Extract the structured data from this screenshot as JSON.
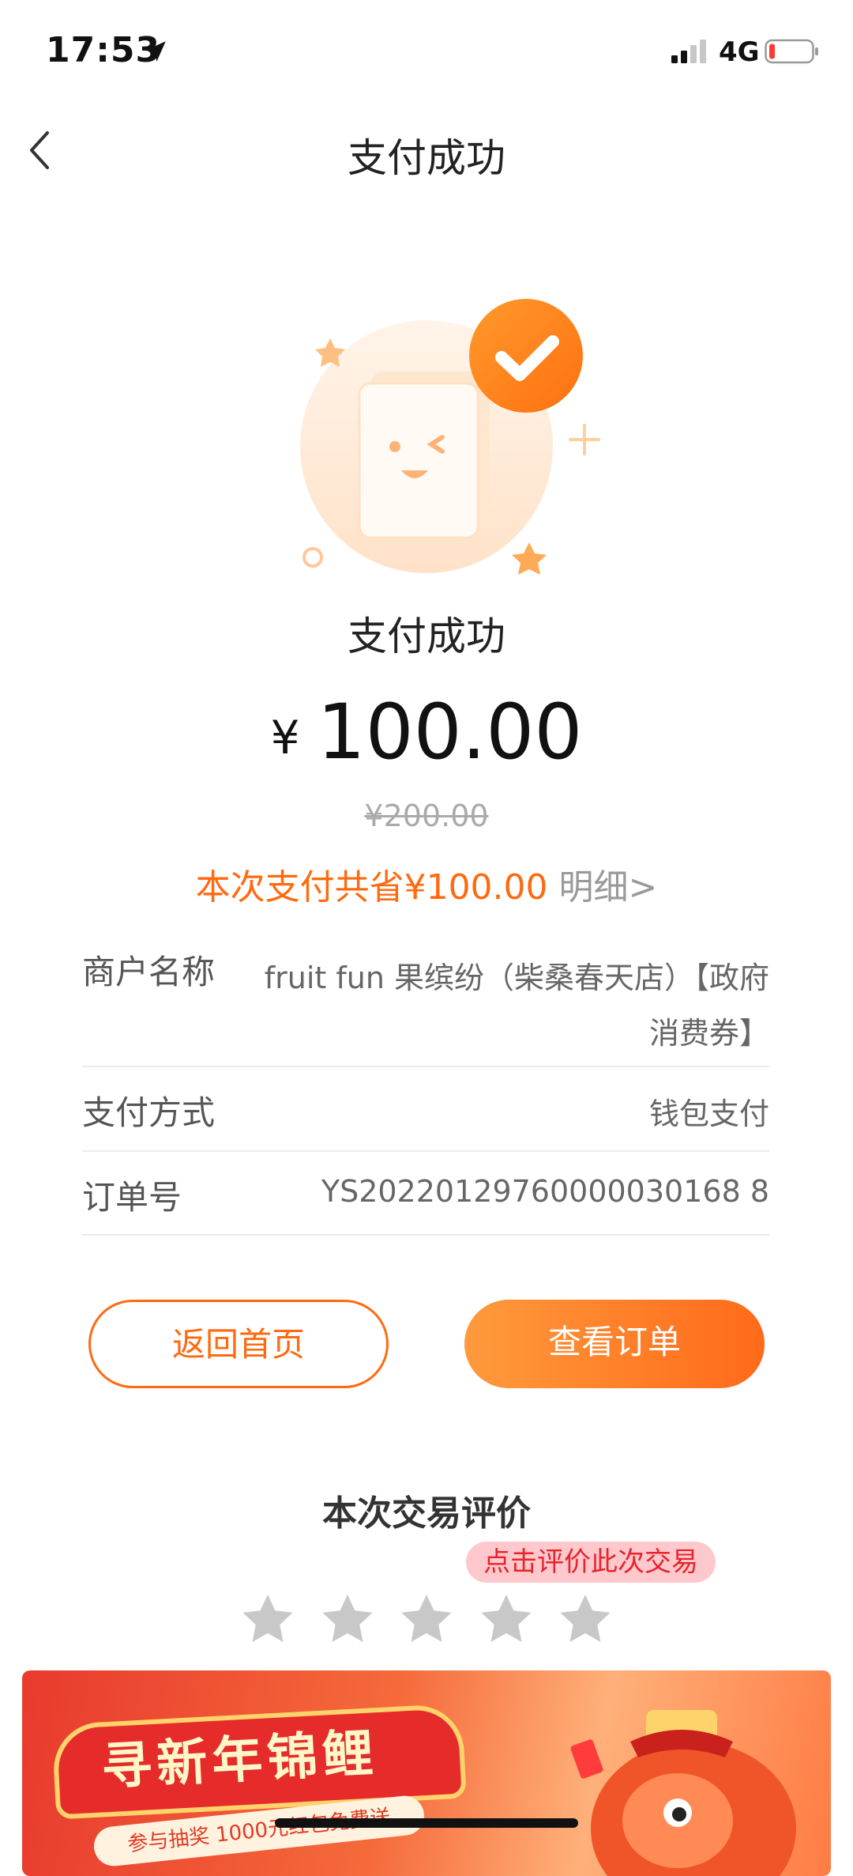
{
  "status_bar": {
    "time": "17:53",
    "network": "4G"
  },
  "nav": {
    "title": "支付成功"
  },
  "result": {
    "title": "支付成功",
    "currency_symbol": "¥",
    "amount": "100.00",
    "original_price": "¥200.00",
    "saving_text": "本次支付共省¥100.00",
    "detail_link": "明细>"
  },
  "info": {
    "merchant": {
      "label": "商户名称",
      "value": "fruit fun 果缤纷（柴桑春天店）【政府消费券】"
    },
    "payment_method": {
      "label": "支付方式",
      "value": "钱包支付"
    },
    "order_no": {
      "label": "订单号",
      "value": "YS20220129760000030168 8"
    }
  },
  "buttons": {
    "home": "返回首页",
    "view_order": "查看订单"
  },
  "rating": {
    "title": "本次交易评价",
    "tip": "点击评价此次交易",
    "star_count": 5,
    "rating": 0
  },
  "banner": {
    "title": "寻新年锦鲤",
    "subtitle": "参与抽奖 1000元红包免费送"
  },
  "colors": {
    "accent": "#ff6a10",
    "star": "#c8c8c8",
    "tip_bg": "#ffc8cc",
    "tip_text": "#e8232a"
  }
}
